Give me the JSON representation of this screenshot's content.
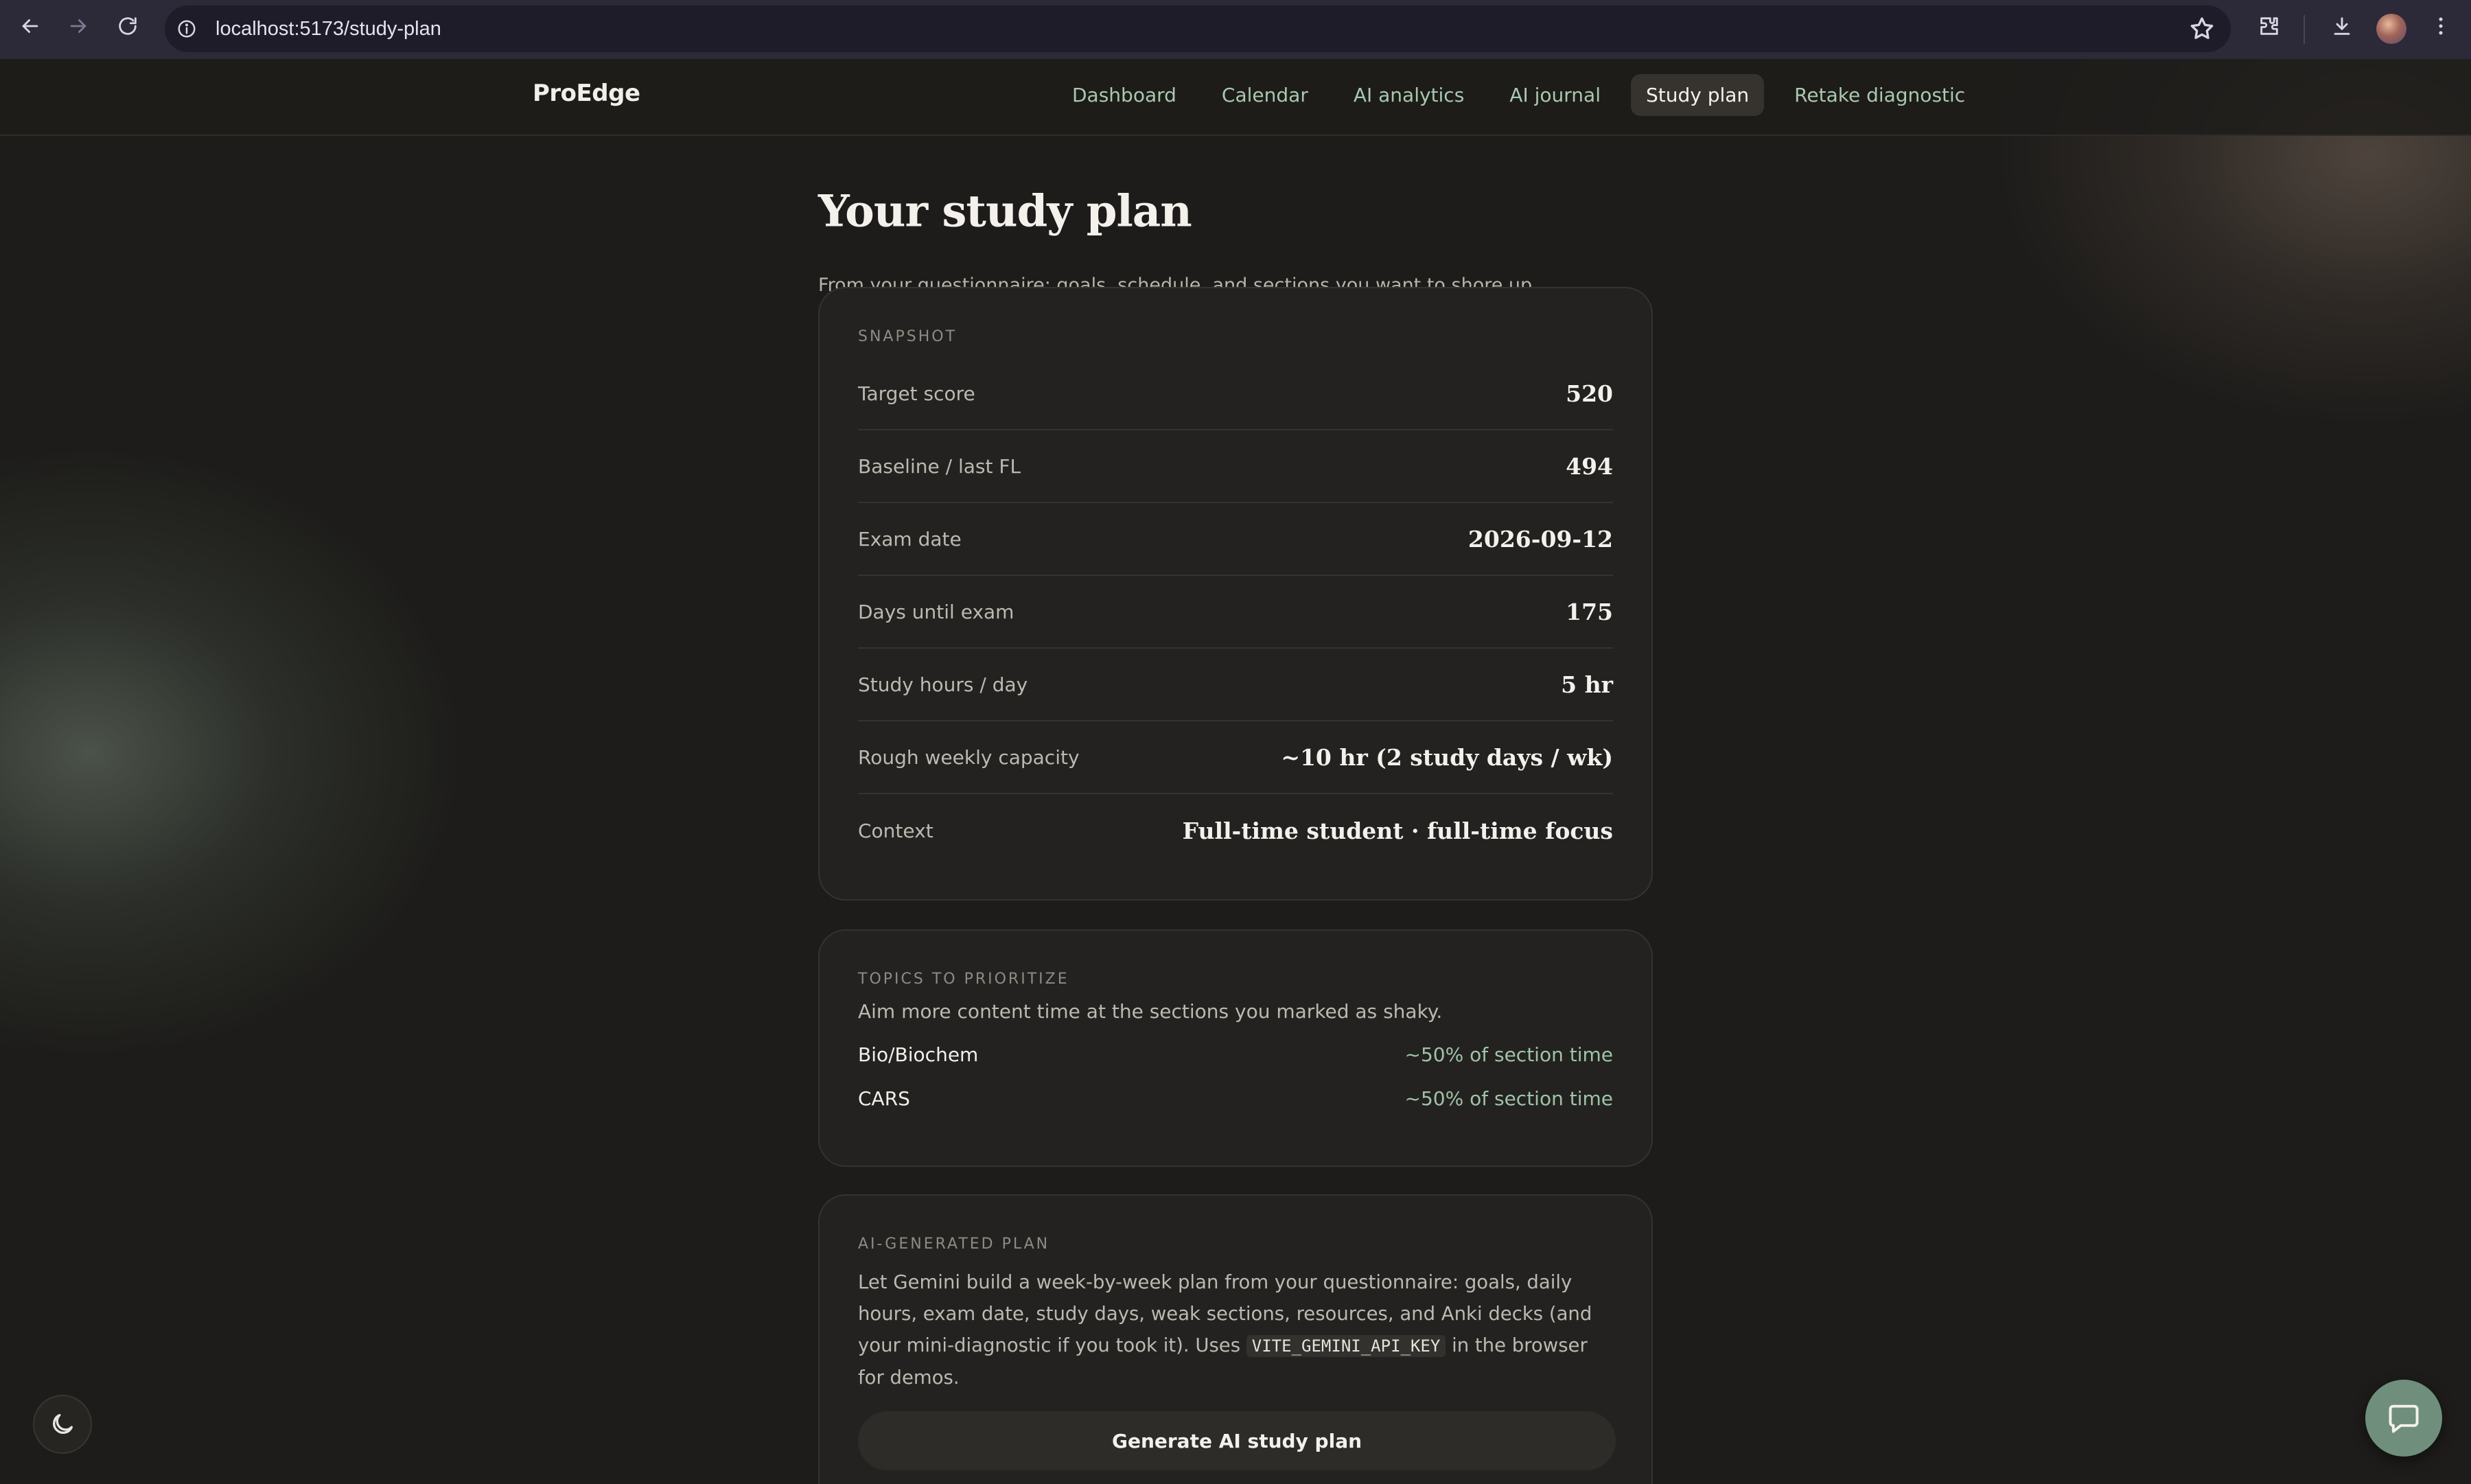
{
  "browser": {
    "url": "localhost:5173/study-plan"
  },
  "nav": {
    "brand": "ProEdge",
    "links": [
      {
        "label": "Dashboard",
        "active": false
      },
      {
        "label": "Calendar",
        "active": false
      },
      {
        "label": "AI analytics",
        "active": false
      },
      {
        "label": "AI journal",
        "active": false
      },
      {
        "label": "Study plan",
        "active": true
      },
      {
        "label": "Retake diagnostic",
        "active": false
      }
    ]
  },
  "page": {
    "title": "Your study plan",
    "subtitle": "From your questionnaire: goals, schedule, and sections you want to shore up."
  },
  "snapshot": {
    "label": "Snapshot",
    "rows": [
      {
        "key": "Target score",
        "value": "520"
      },
      {
        "key": "Baseline / last FL",
        "value": "494"
      },
      {
        "key": "Exam date",
        "value": "2026-09-12"
      },
      {
        "key": "Days until exam",
        "value": "175"
      },
      {
        "key": "Study hours / day",
        "value": "5 hr"
      },
      {
        "key": "Rough weekly capacity",
        "value": "~10 hr (2 study days / wk)"
      },
      {
        "key": "Context",
        "value": "Full-time student · full-time focus"
      }
    ]
  },
  "topics": {
    "label": "Topics to prioritize",
    "description": "Aim more content time at the sections you marked as shaky.",
    "items": [
      {
        "name": "Bio/Biochem",
        "share": "~50% of section time"
      },
      {
        "name": "CARS",
        "share": "~50% of section time"
      }
    ]
  },
  "ai_plan": {
    "label": "AI-generated plan",
    "description_before": "Let Gemini build a week-by-week plan from your questionnaire: goals, daily hours, exam date, study days, weak sections, resources, and Anki decks (and your mini-diagnostic if you took it). Uses ",
    "code": "VITE_GEMINI_API_KEY",
    "description_after": " in the browser for demos.",
    "button_label": "Generate AI study plan"
  },
  "colors": {
    "accent_green": "#a9c8b0",
    "chat_button": "#6f8f7c",
    "background": "#1d1c1a",
    "card": "#232220"
  },
  "icons": {
    "theme_toggle": "moon-icon",
    "chat": "chat-bubble-icon"
  }
}
